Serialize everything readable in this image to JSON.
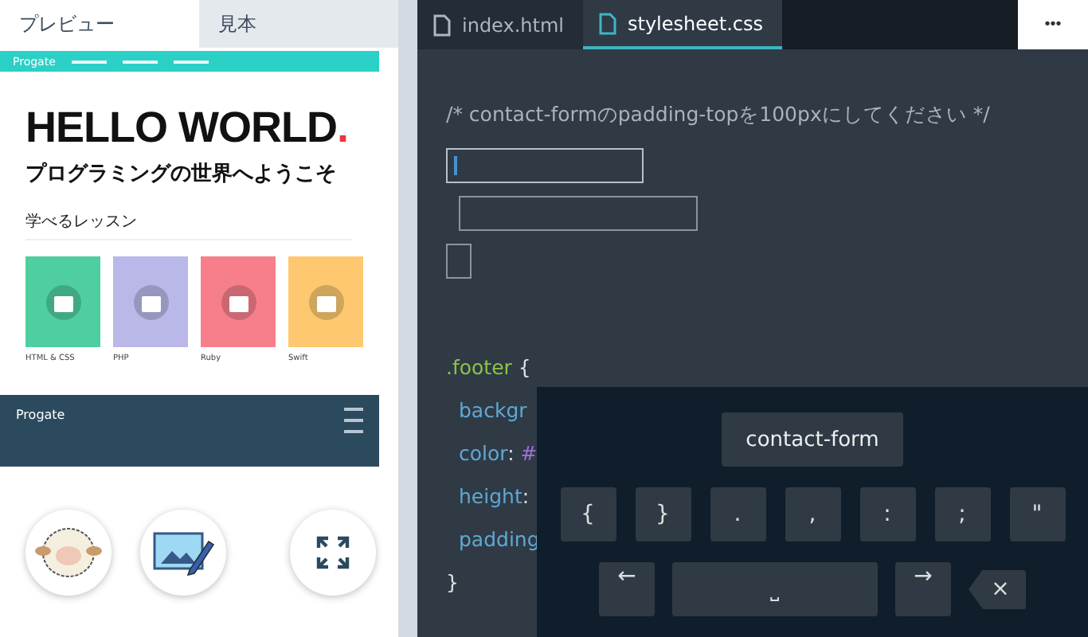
{
  "preview_tabs": [
    {
      "label": "プレビュー",
      "selected": true
    },
    {
      "label": "見本",
      "selected": false
    }
  ],
  "preview": {
    "logo": "Progate",
    "title": "HELLO WORLD",
    "title_accent": ".",
    "subtitle": "プログラミングの世界へようこそ",
    "section_heading": "学べるレッスン",
    "lessons": [
      {
        "label": "HTML & CSS",
        "color": "#4fcfa0"
      },
      {
        "label": "PHP",
        "color": "#b9b8e8"
      },
      {
        "label": "Ruby",
        "color": "#f77f8b"
      },
      {
        "label": "Swift",
        "color": "#fdc86f"
      }
    ],
    "footer_logo": "Progate"
  },
  "preview_buttons": [
    {
      "kind": "sheep"
    },
    {
      "kind": "slide"
    },
    {
      "kind": "expand"
    }
  ],
  "file_tabs": [
    {
      "label": "index.html",
      "selected": false
    },
    {
      "label": "stylesheet.css",
      "selected": true
    }
  ],
  "menu_button": "•••",
  "editor": {
    "comment": "/* contact-formのpadding-topを100pxにしてください */",
    "blanks": [
      {
        "kind": "selector",
        "focused": true
      },
      {
        "kind": "property",
        "focused": false
      },
      {
        "kind": "brace",
        "focused": false
      }
    ],
    "selector": ".footer",
    "open_brace": "{",
    "lines": [
      {
        "property": "backgr"
      },
      {
        "property": "color",
        "colon": ":",
        "value": "#"
      },
      {
        "property": "height",
        "colon": ":"
      },
      {
        "property": "padding"
      }
    ],
    "close_brace": "}"
  },
  "keyboard": {
    "suggestion": "contact-form",
    "keys": [
      "{",
      "}",
      ".",
      ",",
      ":",
      ";",
      "\""
    ],
    "nav_keys": [
      {
        "kind": "left",
        "label": "←"
      },
      {
        "kind": "space",
        "label": "⎵"
      },
      {
        "kind": "right",
        "label": "→"
      },
      {
        "kind": "delete",
        "label": "×"
      }
    ]
  }
}
